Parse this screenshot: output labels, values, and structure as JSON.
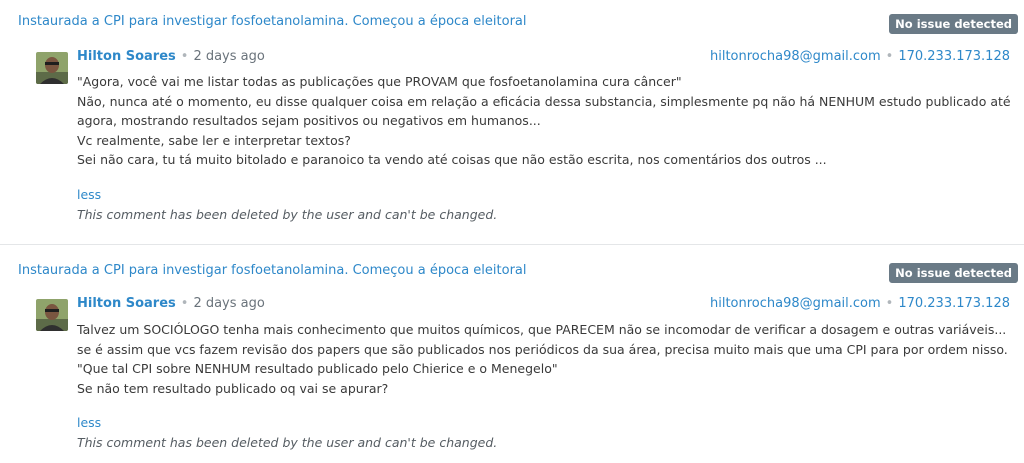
{
  "comments": [
    {
      "thread_title": "Instaurada a CPI para investigar fosfoetanolamina. Começou a época eleitoral",
      "status_badge": "No issue detected",
      "author": "Hilton Soares",
      "separator": "•",
      "time": "2 days ago",
      "email": "hiltonrocha98@gmail.com",
      "ip": "170.233.173.128",
      "paragraphs": [
        "\"Agora, você vai me listar todas as publicações que PROVAM que fosfoetanolamina cura câncer\"",
        "Não, nunca até o momento, eu disse qualquer coisa em relação a eficácia dessa substancia, simplesmente pq não há NENHUM estudo publicado até agora, mostrando resultados sejam positivos ou negativos em humanos...",
        "Vc realmente, sabe ler e interpretar textos?",
        "Sei não cara, tu tá muito bitolado e paranoico ta vendo até coisas que não estão escrita, nos comentários dos outros ..."
      ],
      "less_label": "less",
      "deleted_notice": "This comment has been deleted by the user and can't be changed."
    },
    {
      "thread_title": "Instaurada a CPI para investigar fosfoetanolamina. Começou a época eleitoral",
      "status_badge": "No issue detected",
      "author": "Hilton Soares",
      "separator": "•",
      "time": "2 days ago",
      "email": "hiltonrocha98@gmail.com",
      "ip": "170.233.173.128",
      "paragraphs": [
        "Talvez um SOCIÓLOGO tenha mais conhecimento que muitos químicos, que PARECEM não se incomodar de verificar a dosagem e outras variáveis... se é assim que vcs fazem revisão dos papers que são publicados nos periódicos da sua área, precisa muito mais que uma CPI para por ordem nisso.",
        "\"Que tal CPI sobre NENHUM resultado publicado pelo Chierice e o Menegelo\"",
        "Se não tem resultado publicado oq vai se apurar?"
      ],
      "less_label": "less",
      "deleted_notice": "This comment has been deleted by the user and can't be changed."
    }
  ],
  "colors": {
    "link": "#2e88c9",
    "badge_bg": "#6a7a86",
    "text": "#3a3a3a"
  }
}
